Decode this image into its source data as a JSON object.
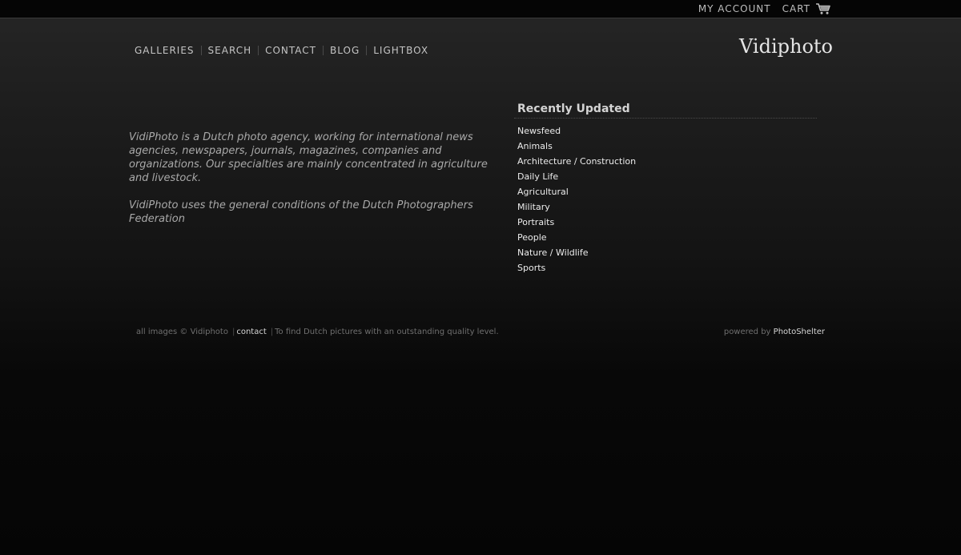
{
  "topbar": {
    "my_account": "MY ACCOUNT",
    "cart": "CART",
    "cart_icon": "shopping-cart-icon"
  },
  "nav": {
    "items": [
      "GALLERIES",
      "SEARCH",
      "CONTACT",
      "BLOG",
      "LIGHTBOX"
    ]
  },
  "brand": "Vidiphoto",
  "about": {
    "paragraph1": "VidiPhoto is a Dutch photo agency, working for international news agencies, newspapers, journals, magazines, companies and organizations. Our specialties are mainly concentrated in agriculture and livestock.",
    "paragraph2": "VidiPhoto uses the general conditions of the Dutch Photographers Federation"
  },
  "recent": {
    "heading": "Recently Updated",
    "items": [
      "Newsfeed",
      "Animals",
      "Architecture / Construction",
      "Daily Life",
      "Agricultural",
      "Military",
      "Portraits",
      "People",
      "Nature / Wildlife",
      "Sports"
    ]
  },
  "footer": {
    "copyright": "all images © Vidiphoto",
    "contact": "contact",
    "tagline": "To find Dutch pictures with an outstanding quality level.",
    "powered_by": "powered by",
    "powered_link": "PhotoShelter"
  },
  "colors": {
    "background_top": "#262626",
    "background_bottom": "#050505",
    "topbar": "#050505",
    "text_primary": "#ececec",
    "text_muted": "#a9a9a9"
  }
}
